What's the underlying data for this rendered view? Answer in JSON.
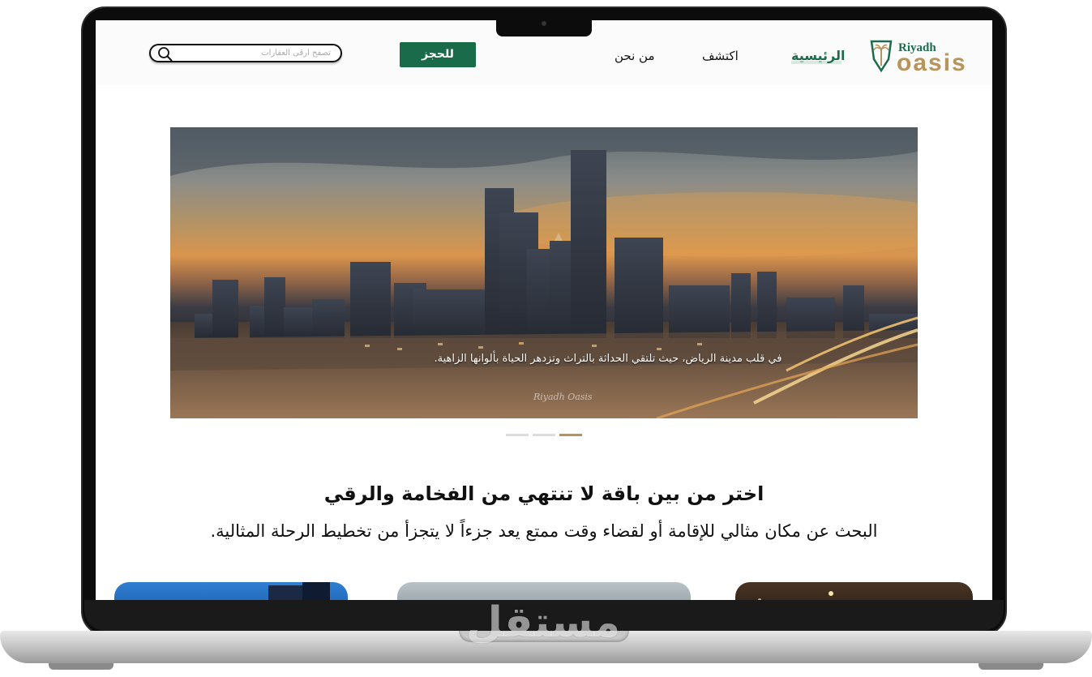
{
  "brand": {
    "line1": "Riyadh",
    "line2": "oasis",
    "green": "#1f6b4d",
    "gold": "#b8945a"
  },
  "nav": {
    "home": "الرئيسية",
    "discover": "اكتشف",
    "about": "من نحن",
    "book": "للحجز"
  },
  "search": {
    "placeholder": "تصفح أرقى العقارات",
    "icon": "search-icon"
  },
  "hero": {
    "caption": "في قلب مدينة الرياض، حيث تلتقي الحداثة بالتراث وتزدهر الحياة بألوانها الزاهية.",
    "signature": "Riyadh Oasis"
  },
  "carousel": {
    "slides": 3,
    "active_index": 3,
    "active_color": "#b8945a"
  },
  "section": {
    "title": "اختر من بين باقة لا تنتهي من الفخامة والرقي",
    "subtitle": "البحث عن مكان مثالي للإقامة أو لقضاء وقت ممتع يعد جزءاً لا يتجزأ من تخطيط الرحلة المثالية."
  },
  "watermark": "مستقل"
}
